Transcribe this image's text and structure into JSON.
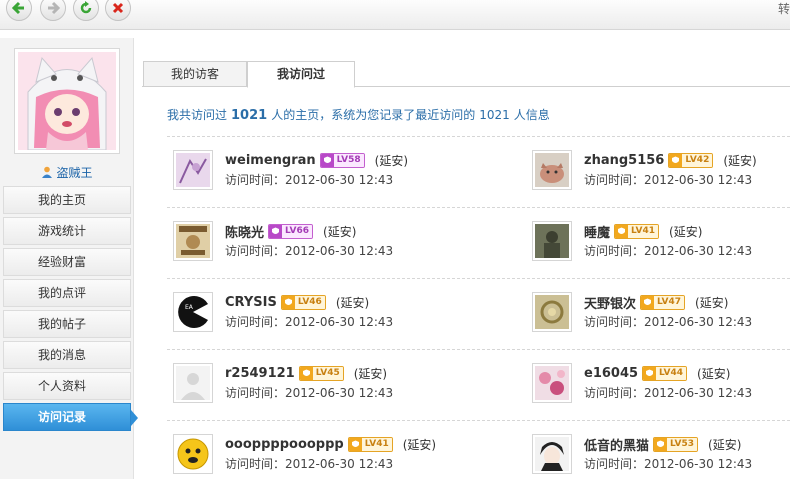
{
  "toolbar": {
    "buttons": [
      {
        "name": "back",
        "icon": "arrow-left-icon"
      },
      {
        "name": "forward",
        "icon": "arrow-right-icon"
      },
      {
        "name": "refresh",
        "icon": "refresh-icon"
      },
      {
        "name": "stop",
        "icon": "close-icon"
      }
    ],
    "right_glyph": "转"
  },
  "profile": {
    "username": "盗贼王",
    "avatar_icon": "anime-avatar"
  },
  "menu": [
    {
      "label": "我的主页",
      "active": false
    },
    {
      "label": "游戏统计",
      "active": false
    },
    {
      "label": "经验财富",
      "active": false
    },
    {
      "label": "我的点评",
      "active": false
    },
    {
      "label": "我的帖子",
      "active": false
    },
    {
      "label": "我的消息",
      "active": false
    },
    {
      "label": "个人资料",
      "active": false
    },
    {
      "label": "访问记录",
      "active": true
    }
  ],
  "tabs": [
    {
      "label": "我的访客",
      "active": false
    },
    {
      "label": "我访问过",
      "active": true
    }
  ],
  "summary": {
    "prefix": "我共访问过",
    "count": "1021",
    "middle": "人的主页，系统为您记录了最近访问的",
    "recent_count": "1021",
    "suffix": "人信息"
  },
  "visit_time_label": "访问时间：",
  "visits": [
    {
      "name": "weimengran",
      "level": "LV58",
      "badge_color": "pink",
      "location": "(延安)",
      "time": "2012-06-30 12:43",
      "avatar": "purple-sketch"
    },
    {
      "name": "zhang5156",
      "level": "LV42",
      "badge_color": "gold",
      "location": "(延安)",
      "time": "2012-06-30 12:43",
      "avatar": "pig"
    },
    {
      "name": "陈晓光",
      "level": "LV66",
      "badge_color": "pink",
      "location": "(延安)",
      "time": "2012-06-30 12:43",
      "avatar": "wanted-poster"
    },
    {
      "name": "睡魔",
      "level": "LV41",
      "badge_color": "gold",
      "location": "(延安)",
      "time": "2012-06-30 12:43",
      "avatar": "soldier"
    },
    {
      "name": "CRYSIS",
      "level": "LV46",
      "badge_color": "gold",
      "location": "(延安)",
      "time": "2012-06-30 12:43",
      "avatar": "ea-pacman"
    },
    {
      "name": "天野银次",
      "level": "LV47",
      "badge_color": "gold",
      "location": "(延安)",
      "time": "2012-06-30 12:43",
      "avatar": "golden-lace"
    },
    {
      "name": "r2549121",
      "level": "LV45",
      "badge_color": "gold",
      "location": "(延安)",
      "time": "2012-06-30 12:43",
      "avatar": "default-user"
    },
    {
      "name": "e16045",
      "level": "LV44",
      "badge_color": "gold",
      "location": "(延安)",
      "time": "2012-06-30 12:43",
      "avatar": "pink-flowers"
    },
    {
      "name": "oooppppoooppp",
      "level": "LV41",
      "badge_color": "gold",
      "location": "(延安)",
      "time": "2012-06-30 12:43",
      "avatar": "yellow-face"
    },
    {
      "name": "低音的黑猫",
      "level": "LV53",
      "badge_color": "gold",
      "location": "(延安)",
      "time": "2012-06-30 12:43",
      "avatar": "anime-boy"
    }
  ],
  "colors": {
    "accent": "#2f8fd7",
    "link": "#2b6ea8",
    "badge_gold": "#f2a81e",
    "badge_pink": "#b849c8"
  }
}
